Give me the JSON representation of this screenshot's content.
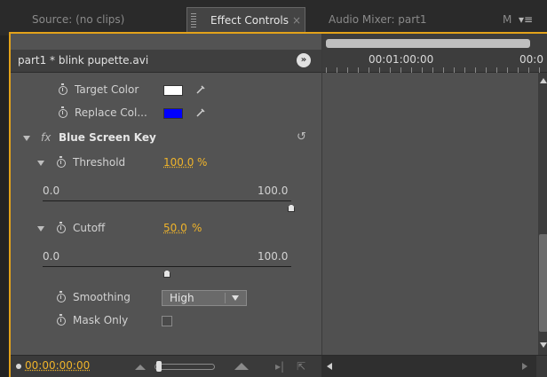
{
  "tabs": {
    "source": "Source: (no clips)",
    "effect_controls": "Effect Controls",
    "audio_mixer": "Audio Mixer: part1",
    "more": "M"
  },
  "header": {
    "clip_title": "part1 * blink pupette.avi"
  },
  "timeline": {
    "timecode_center": "00:01:00:00",
    "timecode_right": "00:0"
  },
  "properties": {
    "target_color": {
      "label": "Target Color",
      "color": "#ffffff"
    },
    "replace_color": {
      "label": "Replace Col...",
      "color": "#0000ff"
    },
    "effect": {
      "fx": "fx",
      "name": "Blue Screen Key"
    },
    "threshold": {
      "label": "Threshold",
      "value": "100.0",
      "unit": "%",
      "min": "0.0",
      "max": "100.0",
      "position": 1.0
    },
    "cutoff": {
      "label": "Cutoff",
      "value": "50.0",
      "unit": "%",
      "min": "0.0",
      "max": "100.0",
      "position": 0.5
    },
    "smoothing": {
      "label": "Smoothing",
      "selected": "High"
    },
    "mask_only": {
      "label": "Mask Only",
      "checked": false
    }
  },
  "footer": {
    "timecode": "00:00:00:00"
  },
  "colors": {
    "accent": "#e3a21a",
    "value_text": "#f0b42a",
    "panel_bg": "#535353"
  }
}
